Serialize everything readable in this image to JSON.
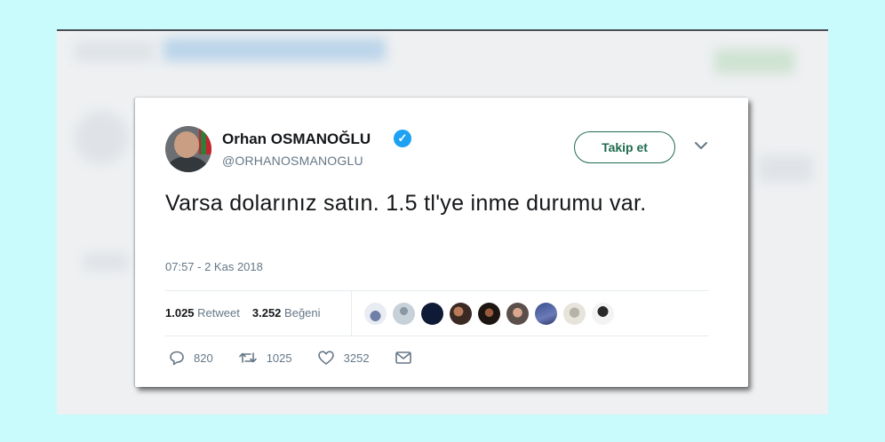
{
  "tweet": {
    "author_name": "Orhan OSMANOĞLU",
    "verified_symbol": "✓",
    "handle": "@ORHANOSMANOGLU",
    "follow_label": "Takip et",
    "text": "Varsa dolarınız satın. 1.5 tl'ye inme durumu var.",
    "timestamp": "07:57 - 2 Kas 2018",
    "retweet_count": "1.025",
    "retweet_label": "Retweet",
    "like_count": "3.252",
    "like_label": "Beğeni",
    "reply_action_count": "820",
    "retweet_action_count": "1025",
    "like_action_count": "3252"
  },
  "icons": [
    "verified-badge-icon",
    "chevron-down-icon",
    "reply-icon",
    "retweet-icon",
    "heart-icon",
    "mail-icon"
  ],
  "colors": {
    "page_background": "#c9fbfd",
    "verified": "#1da1f2",
    "follow_button": "#1f6b4f",
    "secondary_text": "#657786"
  }
}
